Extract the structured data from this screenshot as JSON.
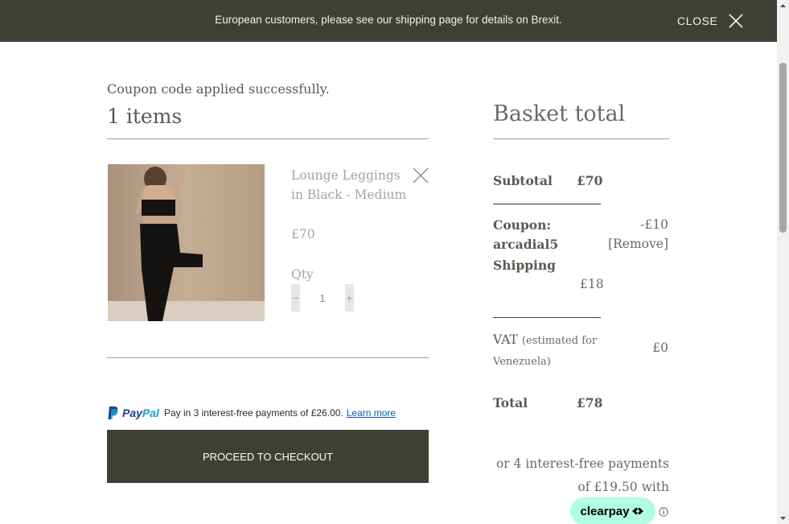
{
  "banner": {
    "message": "European customers, please see our shipping page for details on Brexit.",
    "close_label": "CLOSE",
    "colors": {
      "background": "#3e3f35",
      "text": "#f2f2ec"
    }
  },
  "cart": {
    "coupon_message": "Coupon code applied successfully.",
    "items_count_label": "1 items",
    "items": [
      {
        "name": "Lounge Leggings in Black - Medium",
        "price": "£70",
        "qty_label": "Qty",
        "qty_minus": "−",
        "qty_value": "1",
        "qty_plus": "+"
      }
    ]
  },
  "paypal": {
    "brand_pay": "Pay",
    "brand_pal": "Pal",
    "message": "Pay in 3 interest-free payments of £26.00.",
    "learn_more": "Learn more"
  },
  "checkout": {
    "button_label": "PROCEED TO CHECKOUT"
  },
  "basket_total": {
    "title": "Basket total",
    "subtotal_label": "Subtotal",
    "subtotal_value": "£70",
    "coupon_label": "Coupon:",
    "coupon_code": "arcadial5",
    "coupon_value": "-£10",
    "coupon_remove": "[Remove]",
    "shipping_label": "Shipping",
    "shipping_value": "£18",
    "vat_label": "VAT",
    "vat_note_line1": "(estimated for",
    "vat_note_line2": "Venezuela)",
    "vat_value": "£0",
    "total_label": "Total",
    "total_value": "£78"
  },
  "clearpay": {
    "line1": "or 4 interest-free payments",
    "line2": "of £19.50 with",
    "badge": "clearpay"
  }
}
